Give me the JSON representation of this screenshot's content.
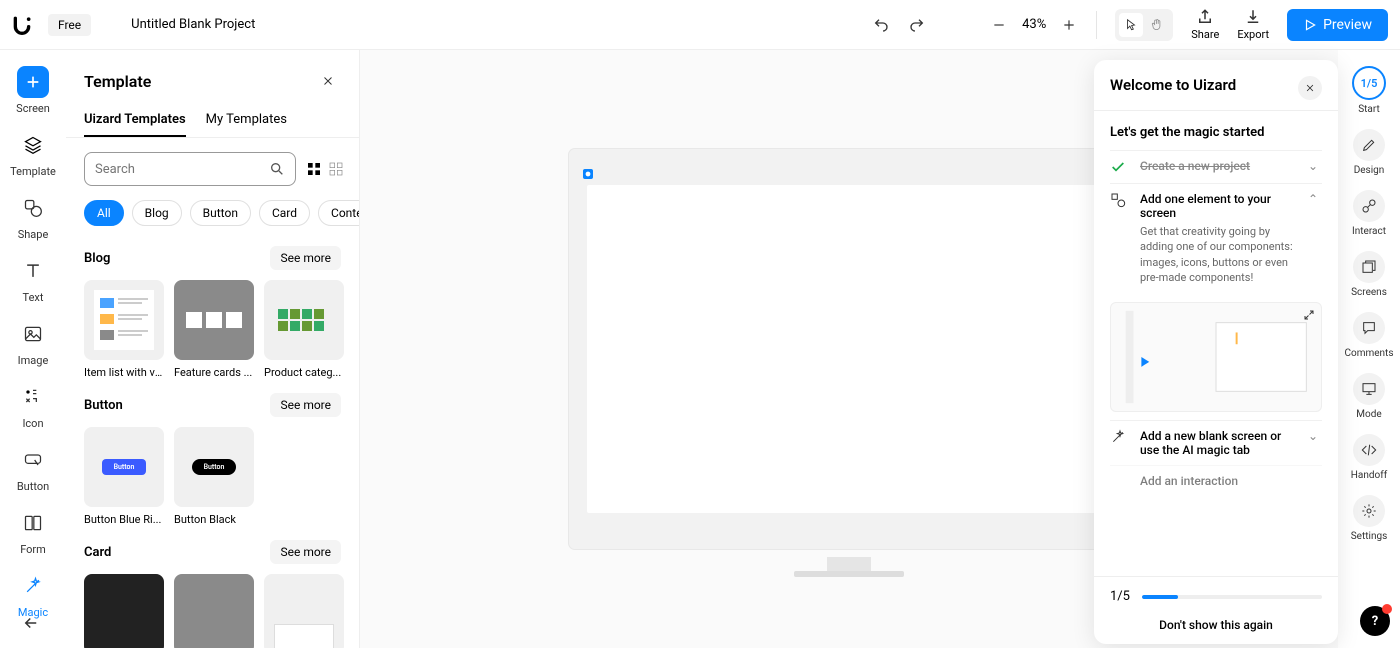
{
  "topbar": {
    "plan_badge": "Free",
    "project_title": "Untitled Blank Project",
    "zoom": "43%",
    "share": "Share",
    "export": "Export",
    "preview": "Preview"
  },
  "left_rail": {
    "items": [
      "Screen",
      "Template",
      "Shape",
      "Text",
      "Image",
      "Icon",
      "Button",
      "Form",
      "Magic"
    ]
  },
  "panel": {
    "title": "Template",
    "tabs": [
      "Uizard Templates",
      "My Templates"
    ],
    "search_placeholder": "Search",
    "chips": [
      "All",
      "Blog",
      "Button",
      "Card",
      "Conte"
    ],
    "sections": {
      "blog": {
        "title": "Blog",
        "see_more": "See more",
        "items": [
          "Item list with vi...",
          "Feature cards ...",
          "Product categ..."
        ]
      },
      "button": {
        "title": "Button",
        "see_more": "See more",
        "items": [
          "Button Blue Ri...",
          "Button Black"
        ],
        "mini": "Button"
      },
      "card": {
        "title": "Card",
        "see_more": "See more"
      }
    }
  },
  "right_rail": {
    "start_badge": "1/5",
    "items": [
      "Start",
      "Design",
      "Interact",
      "Screens",
      "Comments",
      "Mode",
      "Handoff",
      "Settings"
    ]
  },
  "onb": {
    "title": "Welcome to Uizard",
    "subtitle": "Let's get the magic started",
    "steps": {
      "s1": {
        "title": "Create a new project"
      },
      "s2": {
        "title": "Add one element to your screen",
        "desc": "Get that creativity going by adding one of our components: images, icons, buttons or even pre-made components!"
      },
      "s3": {
        "title": "Add a new blank screen or use the AI magic tab"
      },
      "s4": {
        "title": "Add an interaction"
      }
    },
    "progress": "1/5",
    "dont_show": "Don't show this again"
  }
}
